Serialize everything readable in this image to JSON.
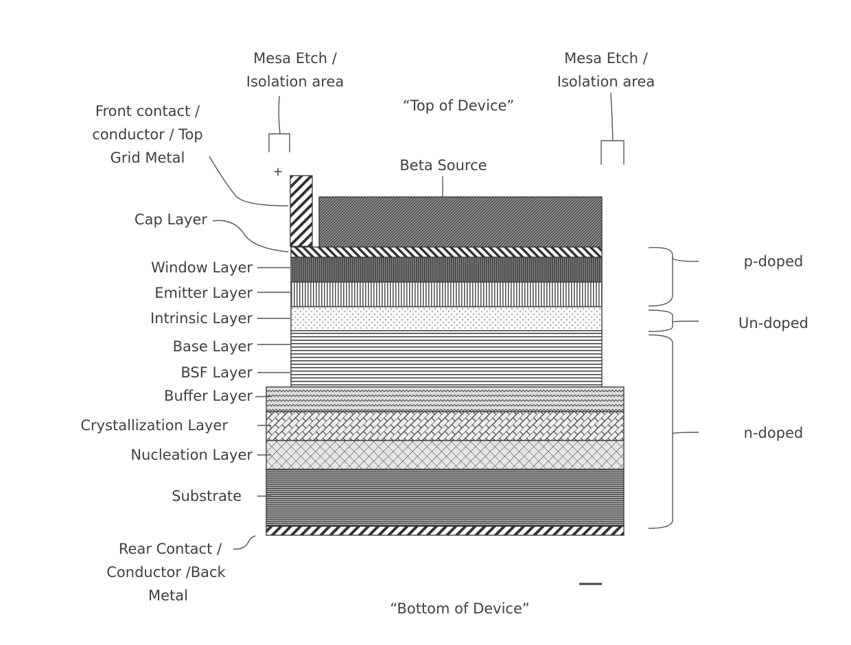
{
  "diagram": {
    "top_caption": "“Top of Device”",
    "bottom_caption": "“Bottom of Device”",
    "plus_sign": "+",
    "mesa_left": [
      "Mesa Etch /",
      "Isolation area"
    ],
    "mesa_right": [
      "Mesa Etch /",
      "Isolation area"
    ],
    "front_contact": [
      "Front contact /",
      "conductor / Top",
      "Grid Metal"
    ],
    "rear_contact": [
      "Rear Contact /",
      "Conductor /Back",
      "Metal"
    ],
    "beta_source": "Beta Source",
    "layers": {
      "cap": "Cap Layer",
      "window": "Window Layer",
      "emitter": "Emitter Layer",
      "intrinsic": "Intrinsic Layer",
      "base": "Base Layer",
      "bsf": "BSF Layer",
      "buffer": "Buffer Layer",
      "crystallization": "Crystallization Layer",
      "nucleation": "Nucleation Layer",
      "substrate": "Substrate"
    },
    "doping": {
      "p": "p-doped",
      "un": "Un-doped",
      "n": "n-doped"
    }
  }
}
